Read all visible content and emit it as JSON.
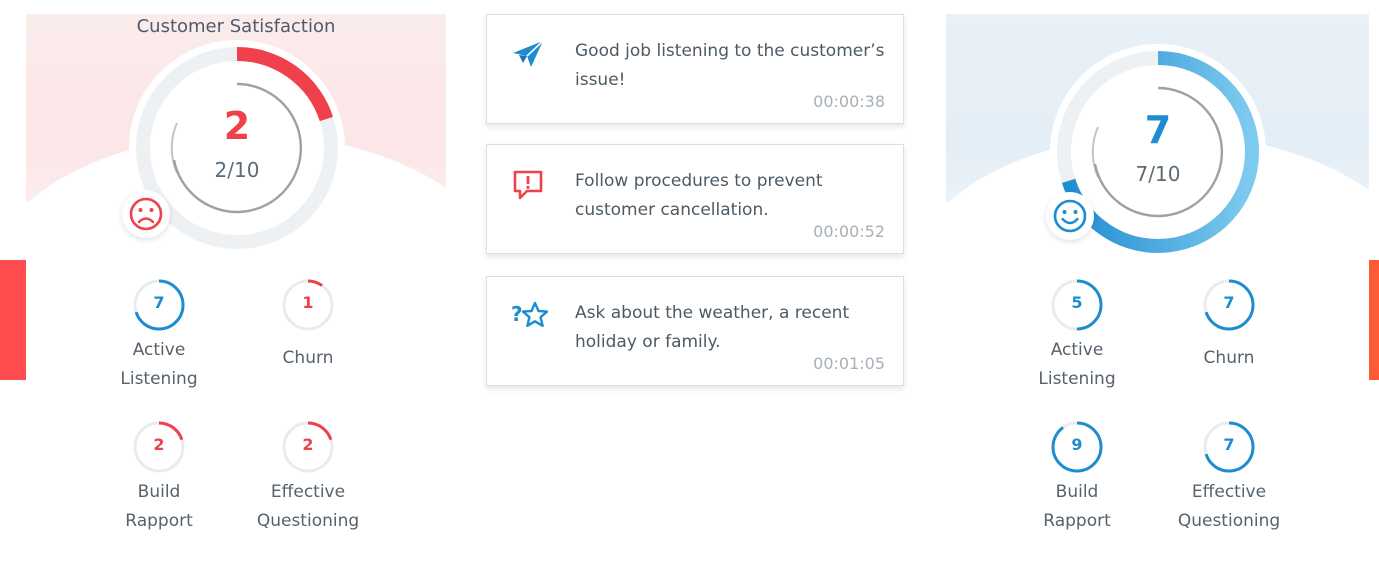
{
  "colors": {
    "negative": "#f0404b",
    "positive": "#1d8cd0",
    "positive_light": "#74c4ea",
    "track": "#e8ecef",
    "edge_left": "#ff4d4f",
    "edge_right": "#ff5a36"
  },
  "left_panel": {
    "title": "Customer Satisfaction",
    "score": "2",
    "score_out_of": "2/10",
    "score_fraction": 0.2,
    "mood_icon": "sad-face-icon",
    "metrics": [
      {
        "value": "7",
        "fraction": 0.7,
        "label_line1": "Active",
        "label_line2": "Listening",
        "tone": "positive"
      },
      {
        "value": "1",
        "fraction": 0.1,
        "label_line1": "Churn",
        "label_line2": "",
        "tone": "negative"
      },
      {
        "value": "2",
        "fraction": 0.2,
        "label_line1": "Build",
        "label_line2": "Rapport",
        "tone": "negative"
      },
      {
        "value": "2",
        "fraction": 0.2,
        "label_line1": "Effective",
        "label_line2": "Questioning",
        "tone": "negative"
      }
    ]
  },
  "feedback": [
    {
      "icon": "paper-plane-icon",
      "text": "Good job listening to the customer’s issue!",
      "time": "00:00:38"
    },
    {
      "icon": "alert-message-icon",
      "text": "Follow procedures to prevent customer cancellation.",
      "time": "00:00:52"
    },
    {
      "icon": "question-star-icon",
      "text": "Ask about the weather, a recent holiday or family.",
      "time": "00:01:05"
    }
  ],
  "right_panel": {
    "score": "7",
    "score_out_of": "7/10",
    "score_fraction": 0.7,
    "mood_icon": "happy-face-icon",
    "metrics": [
      {
        "value": "5",
        "fraction": 0.5,
        "label_line1": "Active",
        "label_line2": "Listening",
        "tone": "positive"
      },
      {
        "value": "7",
        "fraction": 0.7,
        "label_line1": "Churn",
        "label_line2": "",
        "tone": "positive"
      },
      {
        "value": "9",
        "fraction": 0.9,
        "label_line1": "Build",
        "label_line2": "Rapport",
        "tone": "positive"
      },
      {
        "value": "7",
        "fraction": 0.7,
        "label_line1": "Effective",
        "label_line2": "Questioning",
        "tone": "positive"
      }
    ]
  }
}
